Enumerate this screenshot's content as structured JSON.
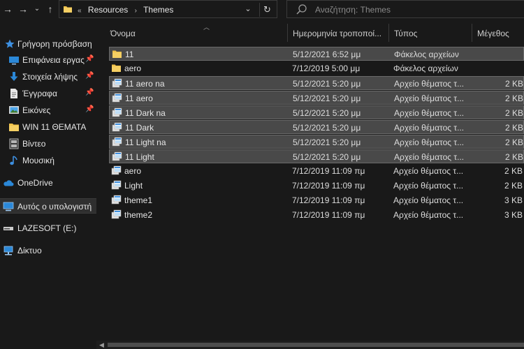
{
  "addressbar": {
    "crumb_prefix": "«",
    "crumbs": [
      "Resources",
      "Themes"
    ],
    "separator": "›"
  },
  "search": {
    "placeholder": "Αναζήτηση: Themes"
  },
  "sidebar": {
    "items": [
      {
        "label": "Γρήγορη πρόσβαση",
        "icon": "star-icon"
      },
      {
        "label": "Επιφάνεια εργας",
        "icon": "desktop-icon",
        "pinned": true
      },
      {
        "label": "Στοιχεία λήψης",
        "icon": "download-icon",
        "pinned": true
      },
      {
        "label": "Έγγραφα",
        "icon": "document-icon",
        "pinned": true
      },
      {
        "label": "Εικόνες",
        "icon": "pictures-icon",
        "pinned": true
      },
      {
        "label": "WIN 11 ΘΕΜΑΤΑ",
        "icon": "folder-icon"
      },
      {
        "label": "Βίντεο",
        "icon": "video-icon"
      },
      {
        "label": "Μουσική",
        "icon": "music-icon"
      },
      {
        "label": "OneDrive",
        "icon": "cloud-icon"
      },
      {
        "label": "Αυτός ο υπολογιστή",
        "icon": "computer-icon"
      },
      {
        "label": "LAZESOFT (E:)",
        "icon": "drive-icon"
      },
      {
        "label": "Δίκτυο",
        "icon": "network-icon"
      }
    ]
  },
  "columns": {
    "name": "Όνομα",
    "date": "Ημερομηνία τροποποί...",
    "type": "Τύπος",
    "size": "Μέγεθος"
  },
  "files": [
    {
      "name": "11",
      "date": "5/12/2021 6:52 μμ",
      "type": "Φάκελος αρχείων",
      "size": "",
      "kind": "folder",
      "selected": true
    },
    {
      "name": "aero",
      "date": "7/12/2019 5:00 μμ",
      "type": "Φάκελος αρχείων",
      "size": "",
      "kind": "folder",
      "selected": false
    },
    {
      "name": "11 aero na",
      "date": "5/12/2021 5:20 μμ",
      "type": "Αρχείο θέματος τ...",
      "size": "2 KB",
      "kind": "theme",
      "selected": true
    },
    {
      "name": "11 aero",
      "date": "5/12/2021 5:20 μμ",
      "type": "Αρχείο θέματος τ...",
      "size": "2 KB",
      "kind": "theme",
      "selected": true
    },
    {
      "name": "11 Dark na",
      "date": "5/12/2021 5:20 μμ",
      "type": "Αρχείο θέματος τ...",
      "size": "2 KB",
      "kind": "theme",
      "selected": true
    },
    {
      "name": "11 Dark",
      "date": "5/12/2021 5:20 μμ",
      "type": "Αρχείο θέματος τ...",
      "size": "2 KB",
      "kind": "theme",
      "selected": true
    },
    {
      "name": "11 Light na",
      "date": "5/12/2021 5:20 μμ",
      "type": "Αρχείο θέματος τ...",
      "size": "2 KB",
      "kind": "theme",
      "selected": true
    },
    {
      "name": "11 Light",
      "date": "5/12/2021 5:20 μμ",
      "type": "Αρχείο θέματος τ...",
      "size": "2 KB",
      "kind": "theme",
      "selected": true
    },
    {
      "name": "aero",
      "date": "7/12/2019 11:09 πμ",
      "type": "Αρχείο θέματος τ...",
      "size": "2 KB",
      "kind": "theme",
      "selected": false
    },
    {
      "name": "Light",
      "date": "7/12/2019 11:09 πμ",
      "type": "Αρχείο θέματος τ...",
      "size": "2 KB",
      "kind": "theme",
      "selected": false
    },
    {
      "name": "theme1",
      "date": "7/12/2019 11:09 πμ",
      "type": "Αρχείο θέματος τ...",
      "size": "3 KB",
      "kind": "theme",
      "selected": false
    },
    {
      "name": "theme2",
      "date": "7/12/2019 11:09 πμ",
      "type": "Αρχείο θέματος τ...",
      "size": "3 KB",
      "kind": "theme",
      "selected": false
    }
  ],
  "colors": {
    "background": "#191919",
    "selection": "#494949",
    "folder": "#f0c24a",
    "accent": "#2b88d8"
  }
}
